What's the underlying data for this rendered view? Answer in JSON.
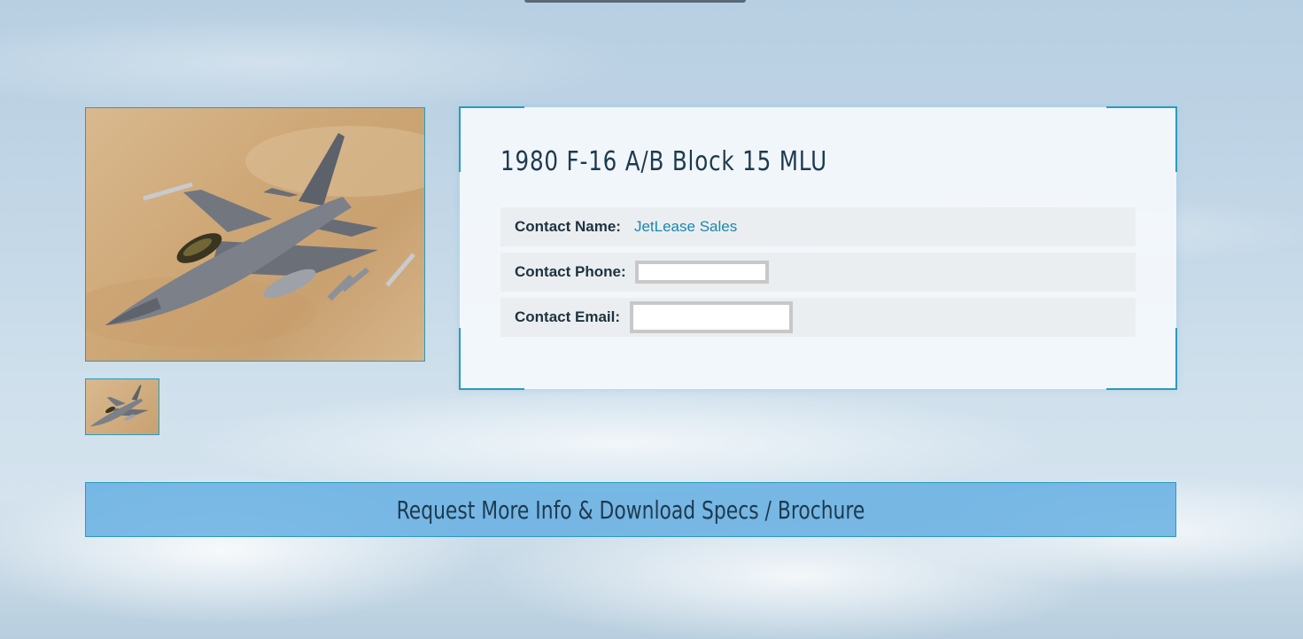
{
  "listing": {
    "title": "1980 F-16 A/B Block 15 MLU"
  },
  "contact": {
    "name_label": "Contact Name:",
    "name_value": "JetLease Sales",
    "phone_label": "Contact Phone:",
    "phone_value": "",
    "email_label": "Contact Email:",
    "email_value": ""
  },
  "gallery": {
    "main_image": "F-16 fighter jet in flight over desert",
    "thumbnails": [
      "F-16 fighter jet thumbnail"
    ]
  },
  "cta": {
    "label": "Request More Info & Download Specs / Brochure"
  },
  "colors": {
    "accent": "#2a9bbf",
    "title_text": "#1d3a4f",
    "link": "#1a87b0",
    "cta_background": "#5caae2"
  }
}
